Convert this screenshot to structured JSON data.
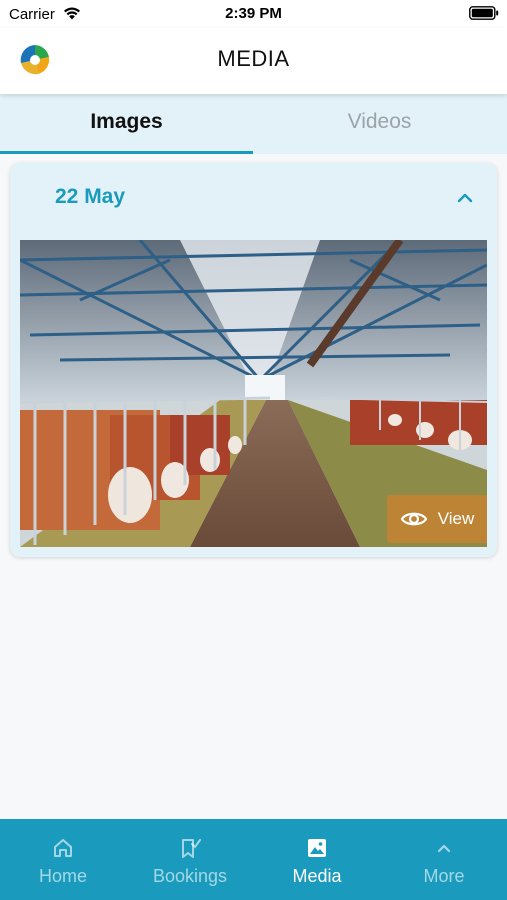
{
  "status_bar": {
    "carrier": "Carrier",
    "time": "2:39 PM"
  },
  "header": {
    "title": "MEDIA"
  },
  "tabs": [
    {
      "label": "Images",
      "active": true
    },
    {
      "label": "Videos",
      "active": false
    }
  ],
  "media_groups": [
    {
      "date": "22 May",
      "expanded": true,
      "items": [
        {
          "view_label": "View",
          "icon": "eye-icon"
        }
      ]
    }
  ],
  "bottom_nav": [
    {
      "label": "Home",
      "icon": "home-icon",
      "active": false
    },
    {
      "label": "Bookings",
      "icon": "bookings-icon",
      "active": false
    },
    {
      "label": "Media",
      "icon": "image-icon",
      "active": true
    },
    {
      "label": "More",
      "icon": "chevron-up-icon",
      "active": false
    }
  ],
  "colors": {
    "accent": "#1a9bbd",
    "tab_bar_bg": "#e3f2f8",
    "view_button": "#c88232"
  }
}
